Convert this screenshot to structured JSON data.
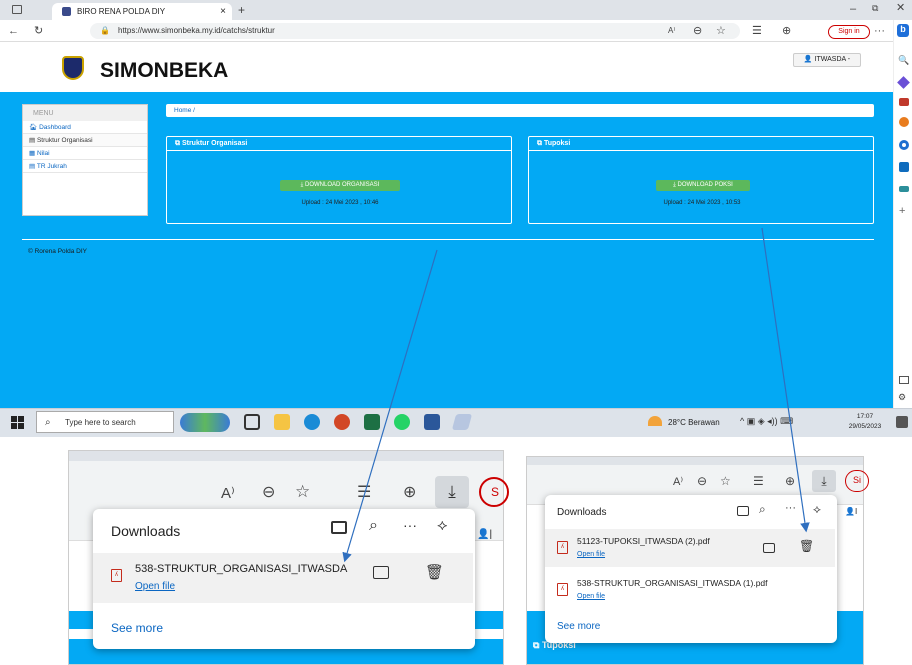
{
  "browser": {
    "tab_title": "BIRO RENA POLDA DIY",
    "url": "https://www.simonbeka.my.id/catchs/struktur",
    "signin_label": "Sign in"
  },
  "site": {
    "brand": "SIMONBEKA",
    "user_label": "ITWASDA -",
    "breadcrumb": "Home /",
    "footer": "© Rorena Polda DIY"
  },
  "menu": {
    "header": "MENU",
    "items": [
      "Dashboard",
      "Struktur Organisasi",
      "Nilai",
      "TR Jukrah"
    ]
  },
  "panels": {
    "struktur": {
      "title": "Struktur Organisasi",
      "button": "DOWNLOAD ORGANISASI",
      "upload": "Upload : 24 Mei 2023 , 10:46"
    },
    "tupoksi": {
      "title": "Tupoksi",
      "button": "DOWNLOAD POKSI",
      "upload": "Upload : 24 Mei 2023 , 10:53"
    }
  },
  "taskbar": {
    "search_placeholder": "Type here to search",
    "weather": "28°C Berawan",
    "time": "17:07",
    "date": "29/05/2023"
  },
  "downloads_left": {
    "title": "Downloads",
    "file": "538-STRUKTUR_ORGANISASI_ITWASDA",
    "open": "Open file",
    "see_more": "See more",
    "partial_btn": "S"
  },
  "downloads_right": {
    "title": "Downloads",
    "files": [
      {
        "name": "51123-TUPOKSI_ITWASDA (2).pdf",
        "open": "Open file"
      },
      {
        "name": "538-STRUKTUR_ORGANISASI_ITWASDA (1).pdf",
        "open": "Open file"
      }
    ],
    "see_more": "See more",
    "behind_text": "Tupoksi",
    "partial_btn": "Si"
  },
  "colors": {
    "page_bg": "#03a9f4",
    "download_btn": "#5cb85c",
    "pdf_icon": "#c42b1c",
    "arrow": "#2f6fbf"
  }
}
